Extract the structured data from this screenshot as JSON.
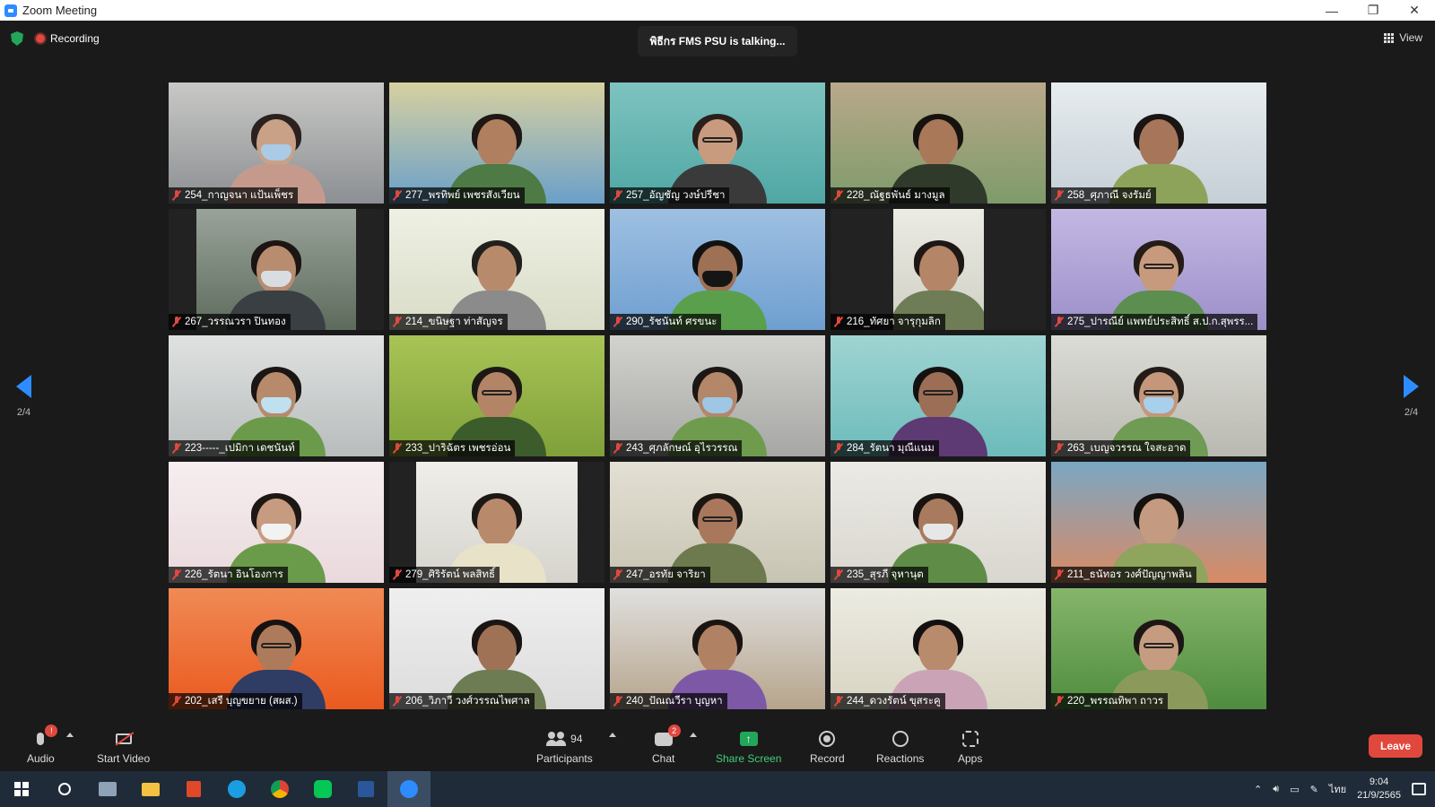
{
  "window": {
    "title": "Zoom Meeting",
    "controls": [
      "—",
      "❐",
      "✕"
    ]
  },
  "top": {
    "recording_label": "Recording",
    "talking": "พิธีกร FMS PSU is talking...",
    "view_label": "View"
  },
  "pager": {
    "left_label": "2/4",
    "right_label": "2/4"
  },
  "tiles": [
    {
      "name": "254_กาญจนา แป้นเพ็ชร",
      "bg": "#8c8f93",
      "wall": "#c8c9c6",
      "skin": "#c9a186",
      "hair": "#2b2220",
      "shirt": "#c59a8d",
      "mask": "#a9cbe6",
      "glasses": false,
      "fw": 1
    },
    {
      "name": "277_พรทิพย์ เพชรสังเวียน",
      "bg": "#6aa0c9",
      "wall": "#d7d0a0",
      "skin": "#b07f60",
      "hair": "#1e1714",
      "shirt": "#4d7a45",
      "mask": "",
      "glasses": false,
      "fw": 1
    },
    {
      "name": "257_อัญชัญ วงษ์ปรีชา",
      "bg": "#4fa7a4",
      "wall": "#7ec3c0",
      "skin": "#c99b7e",
      "hair": "#2a1f1b",
      "shirt": "#3b3a3a",
      "mask": "",
      "glasses": true,
      "fw": 1
    },
    {
      "name": "228_ณัฐธพันธ์ มางมูล",
      "bg": "#7e9b6a",
      "wall": "#b9a88a",
      "skin": "#a87858",
      "hair": "#161210",
      "shirt": "#2f3a2a",
      "mask": "",
      "glasses": false,
      "fw": 1
    },
    {
      "name": "258_ศุภาณี จงรัมย์",
      "bg": "#c4cfd6",
      "wall": "#e7ecef",
      "skin": "#a7765a",
      "hair": "#1a1412",
      "shirt": "#8da35a",
      "mask": "",
      "glasses": false,
      "fw": 1
    },
    {
      "name": "267_วรรณวรา ปินทอง",
      "bg": "#5d6b5c",
      "wall": "#9aa39a",
      "skin": "#b88c6e",
      "hair": "#1b1513",
      "shirt": "#3a3f44",
      "mask": "#d8dde2",
      "glasses": false,
      "fw": 0.74
    },
    {
      "name": "214_ขนิษฐา ท่าสัญจร",
      "bg": "#d9dcc7",
      "wall": "#eef0e4",
      "skin": "#b88a6c",
      "hair": "#22201c",
      "shirt": "#8b8b8b",
      "mask": "",
      "glasses": false,
      "fw": 1
    },
    {
      "name": "290_รัชนันท์ ศรขนะ",
      "bg": "#6f9fd0",
      "wall": "#9ec0e2",
      "skin": "#9e7054",
      "hair": "#121212",
      "shirt": "#5aa04c",
      "mask": "#151515",
      "glasses": false,
      "fw": 1
    },
    {
      "name": "216_ทัศยา จารุกุมลิก",
      "bg": "#cfcfc4",
      "wall": "#ecebe4",
      "skin": "#b48566",
      "hair": "#1d1815",
      "shirt": "#6e7d55",
      "mask": "",
      "glasses": false,
      "fw": 0.42
    },
    {
      "name": "275_ปารณีย์ แพทย์ประสิทธิ์ ส.ป.ก.สุพรร...",
      "bg": "#9c8fc9",
      "wall": "#c3b8e3",
      "skin": "#c89a7d",
      "hair": "#251c18",
      "shirt": "#5c8f4f",
      "mask": "",
      "glasses": true,
      "fw": 1
    },
    {
      "name": "223-----_เปมิกา เดชนันท์",
      "bg": "#b8bcbc",
      "wall": "#dfe2e1",
      "skin": "#b78a6c",
      "hair": "#1b1613",
      "shirt": "#6b9b4a",
      "mask": "#bfe0ef",
      "glasses": false,
      "fw": 1
    },
    {
      "name": "233_ปาริฉัตร เพชรอ่อน",
      "bg": "#7fa03a",
      "wall": "#a8c455",
      "skin": "#b48466",
      "hair": "#1e1815",
      "shirt": "#3c5c2c",
      "mask": "",
      "glasses": true,
      "fw": 1
    },
    {
      "name": "243_ศุภลักษณ์ อุไรวรรณ",
      "bg": "#a6a7a4",
      "wall": "#d2d3cf",
      "skin": "#b4866a",
      "hair": "#1c1714",
      "shirt": "#6e9c4c",
      "mask": "#9fc6e4",
      "glasses": false,
      "fw": 1
    },
    {
      "name": "284_รัตนา มุณีแนม",
      "bg": "#6cbbbb",
      "wall": "#9fd4d2",
      "skin": "#9c6e55",
      "hair": "#141111",
      "shirt": "#5d3a74",
      "mask": "",
      "glasses": true,
      "fw": 1
    },
    {
      "name": "263_เบญจวรรณ ใจสะอาด",
      "bg": "#b9b9b2",
      "wall": "#dcdcd6",
      "skin": "#c4977a",
      "hair": "#231b17",
      "shirt": "#6f9b55",
      "mask": "#a9d0ea",
      "glasses": true,
      "fw": 1
    },
    {
      "name": "226_รัตนา อินโองการ",
      "bg": "#ead9dc",
      "wall": "#f6eef0",
      "skin": "#c69b7f",
      "hair": "#1e1815",
      "shirt": "#6a9b4b",
      "mask": "#f2f2f2",
      "glasses": false,
      "fw": 1
    },
    {
      "name": "279_ศิริรัตน์ พลสิทธิ์",
      "bg": "#d5d3cc",
      "wall": "#efeee9",
      "skin": "#b9896b",
      "hair": "#1e1814",
      "shirt": "#e8e3c8",
      "mask": "",
      "glasses": false,
      "fw": 0.75
    },
    {
      "name": "247_อรทัย จาริยา",
      "bg": "#c8c4b3",
      "wall": "#e3e0d4",
      "skin": "#a9785c",
      "hair": "#1c1613",
      "shirt": "#6c7a4e",
      "mask": "",
      "glasses": true,
      "fw": 1
    },
    {
      "name": "235_สุรภี จุหานุต",
      "bg": "#d9d6cf",
      "wall": "#eceae5",
      "skin": "#a87a5e",
      "hair": "#181311",
      "shirt": "#5f8d47",
      "mask": "#e7e7e7",
      "glasses": false,
      "fw": 1
    },
    {
      "name": "211_ธนัทอร วงศ์ปัญญาพลิน",
      "bg": "#d98a64",
      "wall": "#7aa7c4",
      "skin": "#c49a80",
      "hair": "#15110f",
      "shirt": "#8fa45c",
      "mask": "",
      "glasses": false,
      "fw": 1
    },
    {
      "name": "202_เสรี บุญขยาย (สผส.)",
      "bg": "#ea5a1f",
      "wall": "#f08a55",
      "skin": "#ad7b5c",
      "hair": "#161212",
      "shirt": "#2f3c63",
      "mask": "",
      "glasses": true,
      "fw": 1
    },
    {
      "name": "206_วิภาวี วงศ์วรรณไพศาล",
      "bg": "#dcdcdc",
      "wall": "#efefef",
      "skin": "#9f7256",
      "hair": "#1a1513",
      "shirt": "#6d7c52",
      "mask": "",
      "glasses": false,
      "fw": 1
    },
    {
      "name": "240_ปัณณวีรา บุญหา",
      "bg": "#b6a48c",
      "wall": "#e0e0de",
      "skin": "#b08163",
      "hair": "#1a1512",
      "shirt": "#7d58a6",
      "mask": "",
      "glasses": false,
      "fw": 1
    },
    {
      "name": "244_ดวงรัตน์ ขุสระคู",
      "bg": "#d8d4c2",
      "wall": "#ecebe2",
      "skin": "#b98b6d",
      "hair": "#131010",
      "shirt": "#caa4b6",
      "mask": "",
      "glasses": false,
      "fw": 1
    },
    {
      "name": "220_พรรณทิพา ถาวร",
      "bg": "#4f8c3f",
      "wall": "#86b56a",
      "skin": "#c69c80",
      "hair": "#1c1714",
      "shirt": "#8b9a5a",
      "mask": "",
      "glasses": true,
      "fw": 1
    }
  ],
  "toolbar": {
    "audio_label": "Audio",
    "audio_badge": "!",
    "video_label": "Start Video",
    "participants_label": "Participants",
    "participants_count": "94",
    "chat_label": "Chat",
    "chat_badge": "2",
    "share_label": "Share Screen",
    "record_label": "Record",
    "reactions_label": "Reactions",
    "apps_label": "Apps",
    "leave_label": "Leave"
  },
  "taskbar": {
    "apps": [
      "windows-start-icon",
      "search-icon",
      "file-manager-icon",
      "folder-icon",
      "office-icon",
      "edge-icon",
      "chrome-icon",
      "line-icon",
      "word-icon",
      "zoom-icon"
    ],
    "lang": "ไทย",
    "time": "9:04",
    "date": "21/9/2565"
  },
  "colors": {
    "accent": "#2d8cff",
    "share": "#23a55a",
    "leave": "#e0483e",
    "mute": "#e0483e"
  }
}
